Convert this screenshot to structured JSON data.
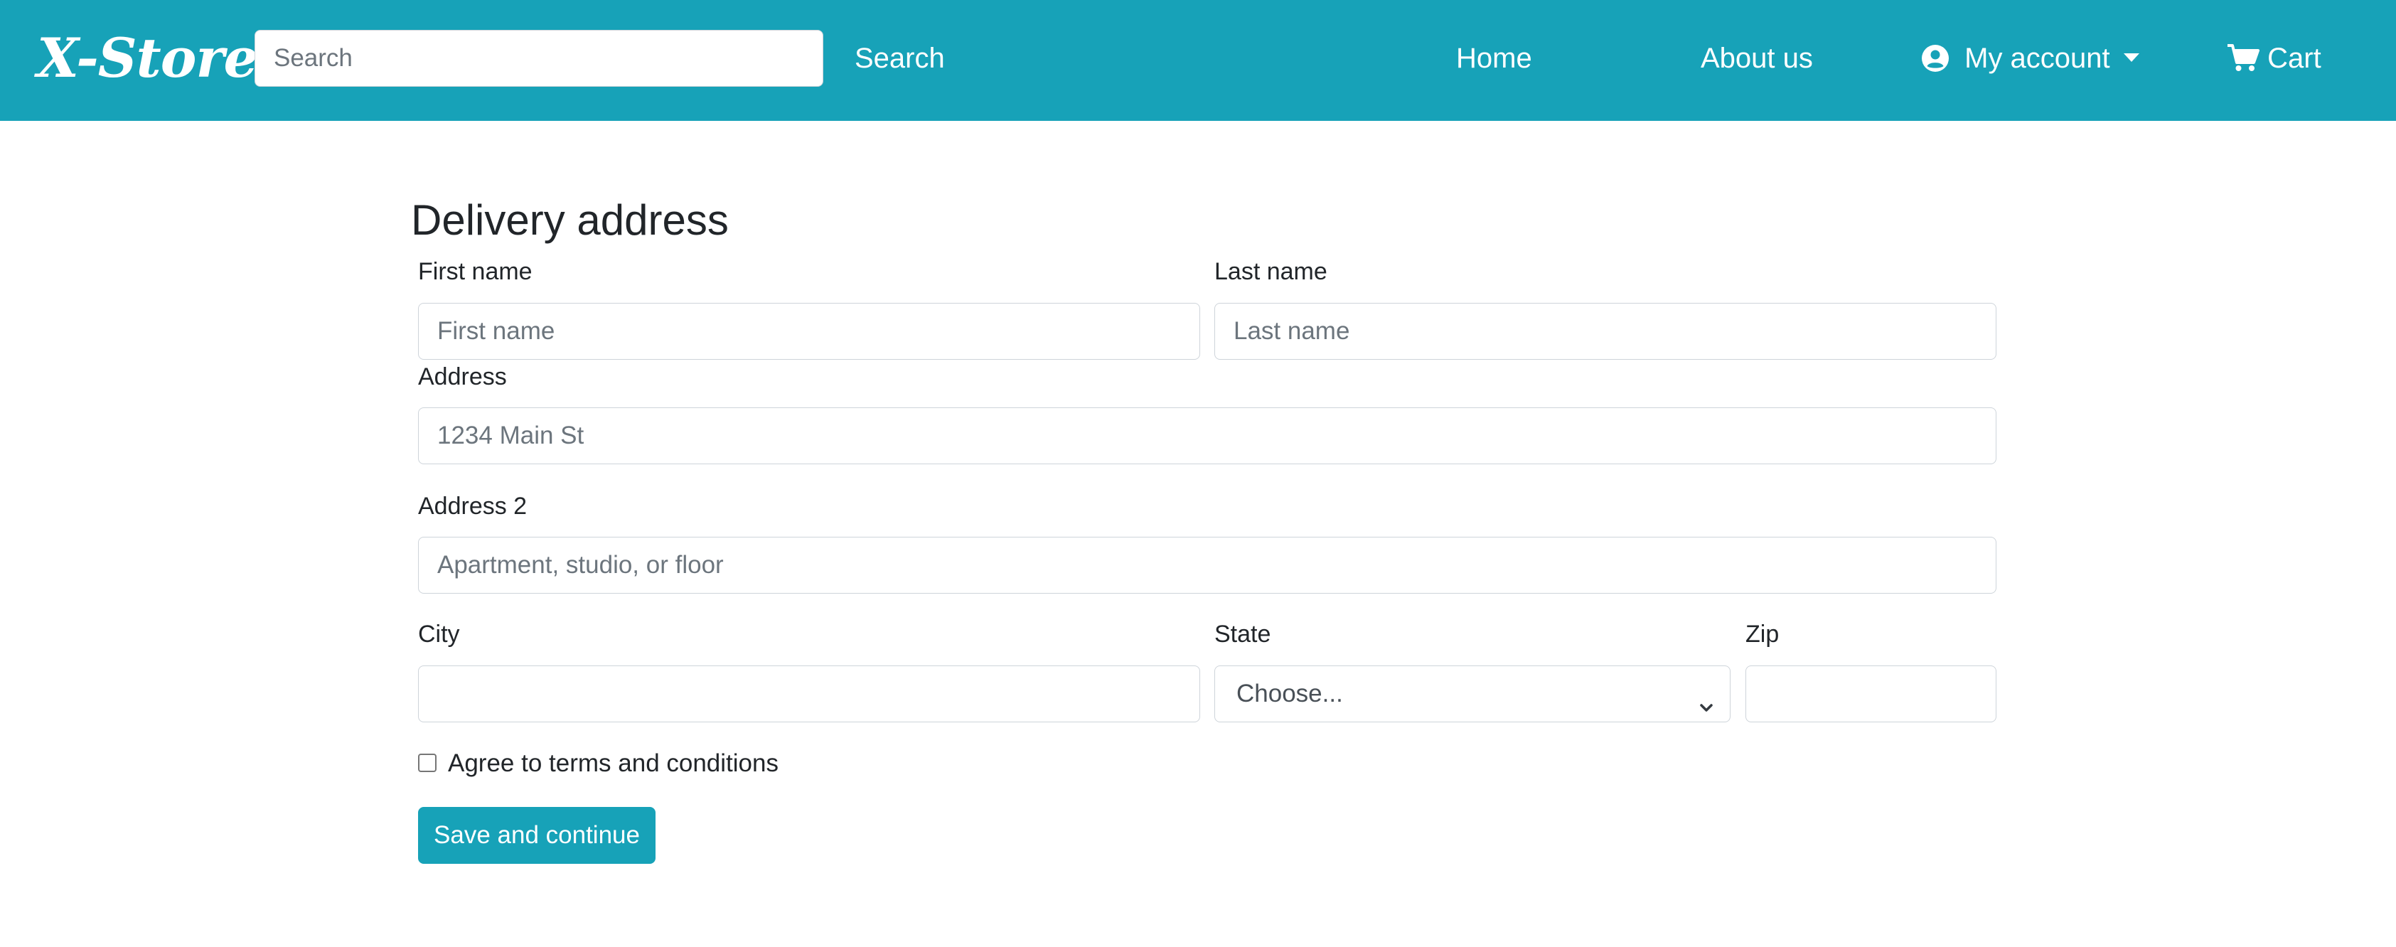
{
  "navbar": {
    "brand": "X-Store",
    "search": {
      "placeholder": "Search",
      "value": ""
    },
    "search_button": "Search",
    "links": {
      "home": "Home",
      "about": "About us",
      "account": "My account",
      "cart": "Cart"
    },
    "icons": {
      "account": "user-circle-icon",
      "account_caret": "caret-down-icon",
      "cart": "shopping-cart-icon"
    }
  },
  "form": {
    "title": "Delivery address",
    "first_name": {
      "label": "First name",
      "placeholder": "First name",
      "value": ""
    },
    "last_name": {
      "label": "Last name",
      "placeholder": "Last name",
      "value": ""
    },
    "address": {
      "label": "Address",
      "placeholder": "1234 Main St",
      "value": ""
    },
    "address2": {
      "label": "Address 2",
      "placeholder": "Apartment, studio, or floor",
      "value": ""
    },
    "city": {
      "label": "City",
      "value": ""
    },
    "state": {
      "label": "State",
      "selected": "Choose..."
    },
    "zip": {
      "label": "Zip",
      "value": ""
    },
    "terms": {
      "label": "Agree to terms and conditions",
      "checked": false
    },
    "submit": "Save and continue"
  },
  "colors": {
    "primary": "#17a2b8",
    "text": "#212529",
    "placeholder": "#6c757d",
    "border": "#ced4da"
  }
}
